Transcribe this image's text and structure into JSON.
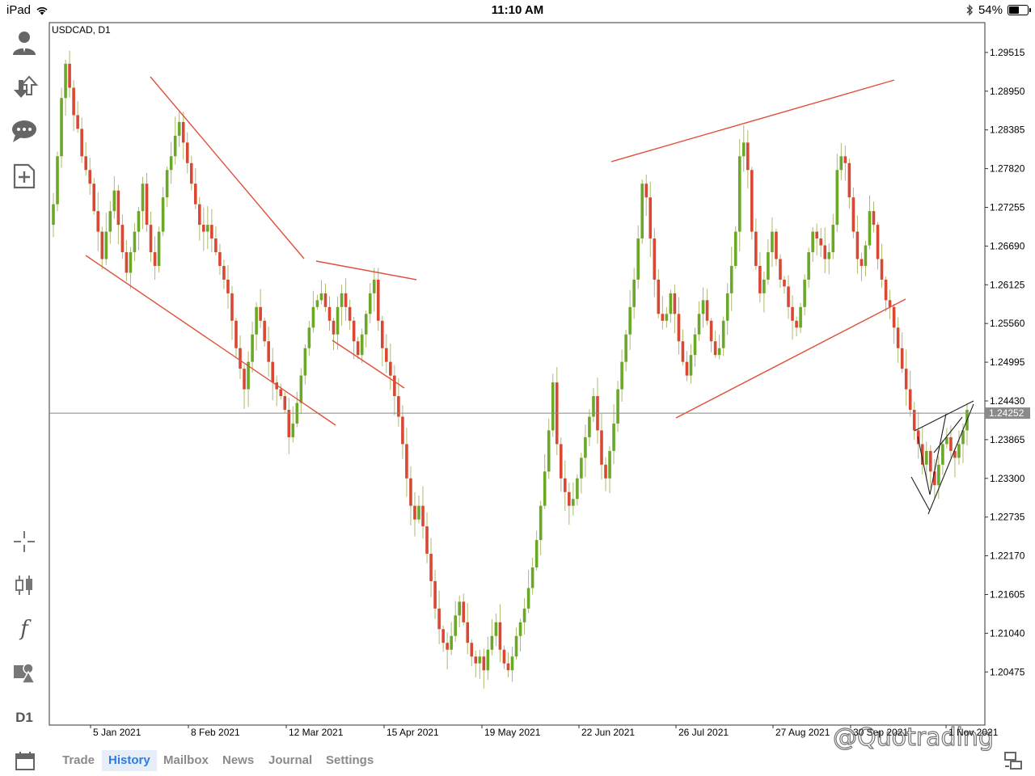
{
  "status_bar": {
    "device": "iPad",
    "time": "11:10 AM",
    "battery": "54%",
    "battery_level": 0.54
  },
  "sidebar": {
    "buttons": [
      "account-icon",
      "trade-arrows-icon",
      "chat-icon",
      "new-order-icon",
      "crosshair-icon",
      "candles-icon",
      "indicators-icon",
      "objects-icon"
    ],
    "indicator_glyph": "f",
    "timeframe": "D1"
  },
  "chart": {
    "symbol": "USDCAD, D1",
    "current_price": "1.24252",
    "colors": {
      "bull": "#6aa828",
      "bear": "#d94835",
      "trendline": "#e0503a",
      "pattern": "#222222",
      "bid_line": "#888888",
      "axis": "#000000"
    }
  },
  "chart_data": {
    "type": "candlestick",
    "title": "USDCAD, D1",
    "y_ticks": [
      "1.29515",
      "1.28950",
      "1.28385",
      "1.27820",
      "1.27255",
      "1.26690",
      "1.26125",
      "1.25560",
      "1.24995",
      "1.24430",
      "1.23865",
      "1.23300",
      "1.22735",
      "1.22170",
      "1.21605",
      "1.21040",
      "1.20475"
    ],
    "x_ticks": [
      "5 Jan 2021",
      "8 Feb 2021",
      "12 Mar 2021",
      "15 Apr 2021",
      "19 May 2021",
      "22 Jun 2021",
      "26 Jul 2021",
      "27 Aug 2021",
      "30 Sep 2021",
      "1 Nov 2021"
    ],
    "ylim": [
      1.197,
      1.2995
    ],
    "bid": 1.24252,
    "closes": [
      1.273,
      1.28,
      1.2885,
      1.2935,
      1.29,
      1.286,
      1.284,
      1.28,
      1.278,
      1.276,
      1.272,
      1.269,
      1.265,
      1.269,
      1.272,
      1.275,
      1.27,
      1.266,
      1.263,
      1.266,
      1.269,
      1.272,
      1.276,
      1.27,
      1.266,
      1.264,
      1.269,
      1.274,
      1.278,
      1.28,
      1.283,
      1.285,
      1.282,
      1.279,
      1.276,
      1.273,
      1.27,
      1.269,
      1.27,
      1.268,
      1.266,
      1.264,
      1.262,
      1.26,
      1.256,
      1.252,
      1.249,
      1.246,
      1.25,
      1.254,
      1.258,
      1.256,
      1.253,
      1.25,
      1.247,
      1.246,
      1.245,
      1.243,
      1.239,
      1.241,
      1.244,
      1.248,
      1.252,
      1.255,
      1.258,
      1.259,
      1.26,
      1.258,
      1.256,
      1.254,
      1.258,
      1.26,
      1.258,
      1.256,
      1.253,
      1.251,
      1.254,
      1.257,
      1.26,
      1.262,
      1.256,
      1.252,
      1.25,
      1.248,
      1.245,
      1.242,
      1.238,
      1.233,
      1.229,
      1.227,
      1.229,
      1.226,
      1.222,
      1.218,
      1.214,
      1.211,
      1.209,
      1.208,
      1.21,
      1.213,
      1.215,
      1.212,
      1.209,
      1.207,
      1.206,
      1.207,
      1.205,
      1.208,
      1.21,
      1.212,
      1.208,
      1.206,
      1.205,
      1.207,
      1.21,
      1.212,
      1.214,
      1.217,
      1.22,
      1.224,
      1.229,
      1.234,
      1.24,
      1.247,
      1.238,
      1.233,
      1.231,
      1.229,
      1.23,
      1.233,
      1.236,
      1.239,
      1.242,
      1.245,
      1.24,
      1.235,
      1.233,
      1.237,
      1.241,
      1.246,
      1.25,
      1.254,
      1.258,
      1.262,
      1.268,
      1.276,
      1.274,
      1.268,
      1.262,
      1.257,
      1.256,
      1.257,
      1.26,
      1.257,
      1.253,
      1.25,
      1.248,
      1.251,
      1.254,
      1.257,
      1.259,
      1.256,
      1.253,
      1.251,
      1.252,
      1.256,
      1.26,
      1.264,
      1.269,
      1.28,
      1.282,
      1.278,
      1.269,
      1.264,
      1.26,
      1.262,
      1.266,
      1.269,
      1.265,
      1.262,
      1.261,
      1.258,
      1.256,
      1.255,
      1.258,
      1.262,
      1.266,
      1.269,
      1.268,
      1.267,
      1.265,
      1.266,
      1.27,
      1.278,
      1.28,
      1.279,
      1.274,
      1.269,
      1.265,
      1.264,
      1.267,
      1.272,
      1.27,
      1.265,
      1.262,
      1.259,
      1.258,
      1.255,
      1.252,
      1.249,
      1.246,
      1.243,
      1.24,
      1.238,
      1.235,
      1.237,
      1.234,
      1.232,
      1.235,
      1.238,
      1.239,
      1.237,
      1.236,
      1.238,
      1.24,
      1.243
    ],
    "annotations": [
      "descending channel Jan-Mar 2021",
      "flag Mar-Apr 2021",
      "rising channel Jun-Sep 2021",
      "rising wedge Oct 2021"
    ]
  },
  "x_watermark": "@Quotrading",
  "tabs": [
    {
      "label": "Trade",
      "active": false
    },
    {
      "label": "History",
      "active": true
    },
    {
      "label": "Mailbox",
      "active": false
    },
    {
      "label": "News",
      "active": false
    },
    {
      "label": "Journal",
      "active": false
    },
    {
      "label": "Settings",
      "active": false
    }
  ]
}
